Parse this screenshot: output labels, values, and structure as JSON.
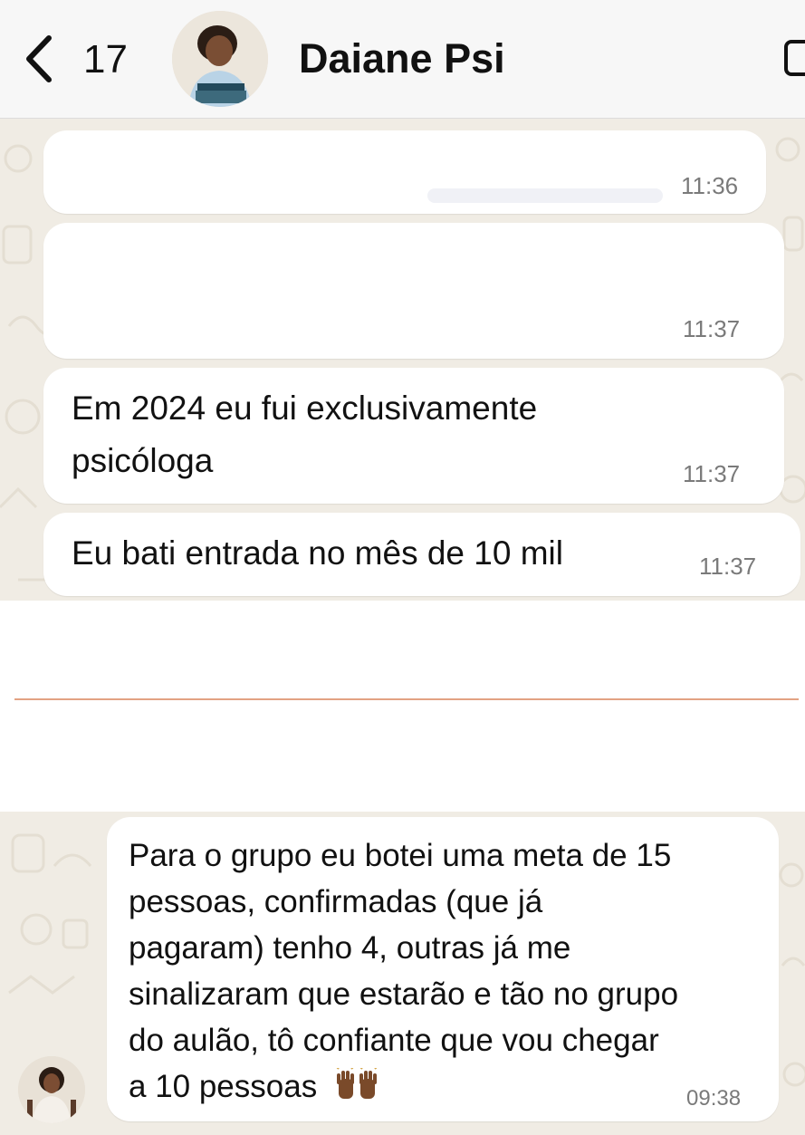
{
  "header": {
    "back_count": "17",
    "contact_name": "Daiane Psi"
  },
  "messages_top": [
    {
      "text": "",
      "time": "11:36"
    },
    {
      "text": "",
      "time": "11:37"
    },
    {
      "text_lines": [
        "Em 2024 eu fui exclusivamente",
        "psicóloga"
      ],
      "time": "11:37"
    },
    {
      "text": "Eu bati entrada no mês de 10 mil",
      "time": "11:37"
    }
  ],
  "messages_bottom": [
    {
      "text_lines": [
        "Para o grupo eu botei uma meta de 15",
        "pessoas, confirmadas (que já",
        "pagaram) tenho 4, outras já me",
        "sinalizaram que estarão e tão no grupo",
        "do aulão, tô confiante que vou chegar",
        "a 10 pessoas"
      ],
      "emoji": "raising-hands-emoji",
      "time": "09:38"
    }
  ],
  "colors": {
    "chat_background": "#f0ece4",
    "bubble": "#ffffff",
    "header": "#f7f7f7",
    "divider": "#e3a283",
    "timestamp": "#7a7a7a"
  }
}
